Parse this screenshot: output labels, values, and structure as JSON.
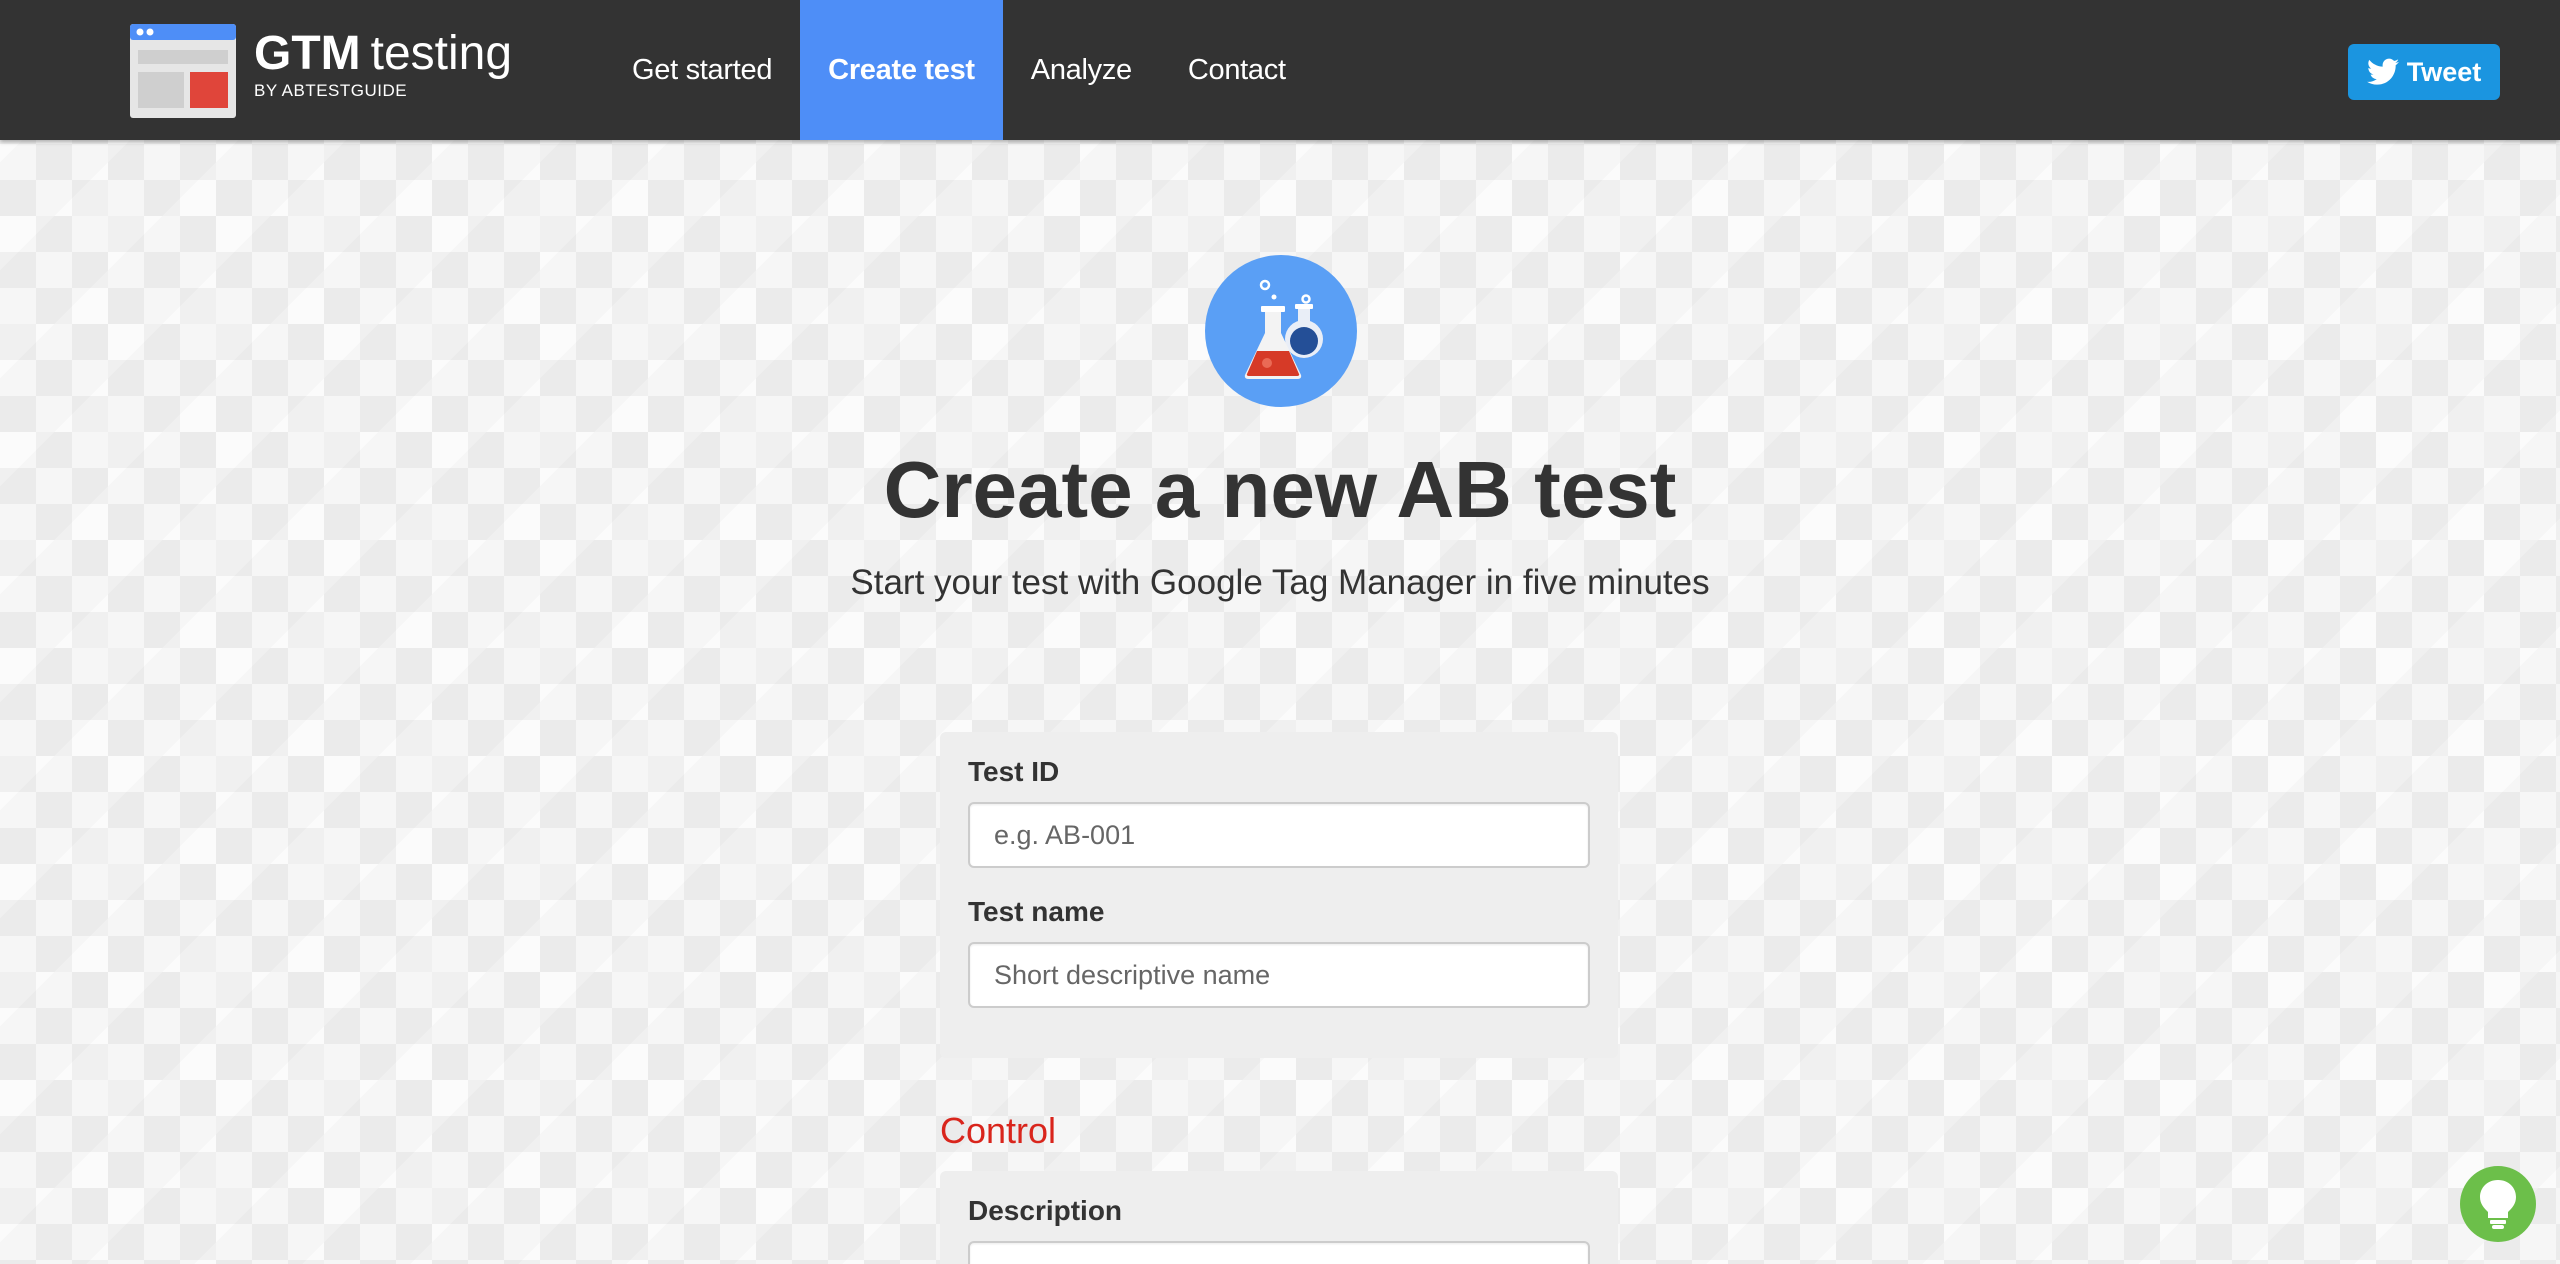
{
  "header": {
    "brand": {
      "title_bold": "GTM",
      "title_light": "testing",
      "subtitle": "BY ABTESTGUIDE",
      "logo_icon": "browser-window-icon"
    },
    "nav": [
      {
        "label": "Get started",
        "active": false
      },
      {
        "label": "Create test",
        "active": true
      },
      {
        "label": "Analyze",
        "active": false
      },
      {
        "label": "Contact",
        "active": false
      }
    ],
    "tweet_label": "Tweet",
    "tweet_icon": "twitter-bird-icon"
  },
  "hero": {
    "icon": "lab-flask-icon",
    "title": "Create a new AB test",
    "subtitle": "Start your test with Google Tag Manager in five minutes"
  },
  "form": {
    "test_id": {
      "label": "Test ID",
      "placeholder": "e.g. AB-001",
      "value": ""
    },
    "test_name": {
      "label": "Test name",
      "placeholder": "Short descriptive name",
      "value": ""
    },
    "control": {
      "heading": "Control",
      "description_label": "Description"
    }
  },
  "help_icon": "lightbulb-icon",
  "colors": {
    "navbar": "#333333",
    "nav_active": "#4e8ef7",
    "tweet": "#1b95e0",
    "accent_red": "#d9251c",
    "help_green": "#6cbf4a"
  }
}
